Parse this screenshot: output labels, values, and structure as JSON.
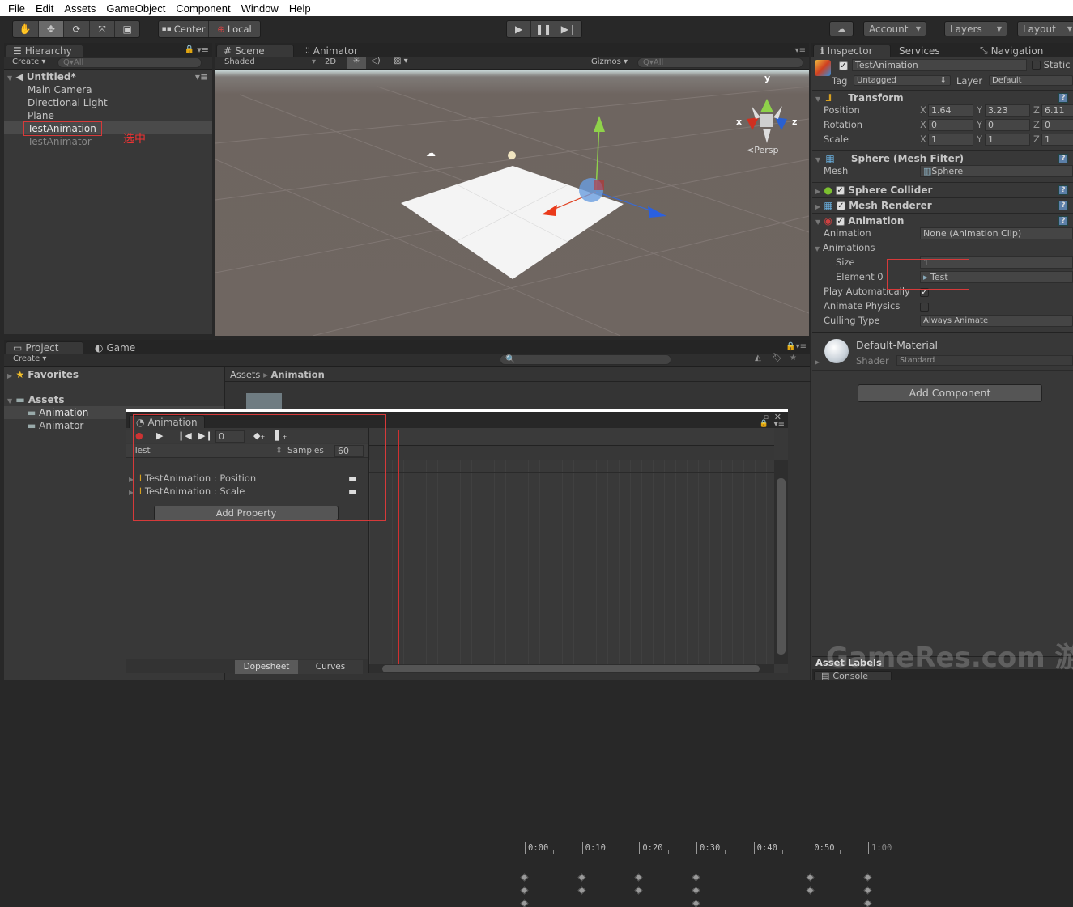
{
  "menu": [
    "File",
    "Edit",
    "Assets",
    "GameObject",
    "Component",
    "Window",
    "Help"
  ],
  "toolbar": {
    "tools": [
      "hand-icon",
      "move-icon",
      "rotate-icon",
      "scale-icon",
      "rect-icon"
    ],
    "active_tool": "move-icon",
    "pivot": "Center",
    "space": "Local",
    "play_controls": [
      "play-icon",
      "pause-icon",
      "step-icon"
    ],
    "account": "Account",
    "layers": "Layers",
    "layout": "Layout"
  },
  "hierarchy": {
    "tab": "Hierarchy",
    "create": "Create",
    "search_placeholder": "Q▾All",
    "scene": "Untitled*",
    "items": [
      "Main Camera",
      "Directional Light",
      "Plane",
      "TestAnimation",
      "TestAnimator"
    ],
    "selected": "TestAnimation",
    "annotation": "选中"
  },
  "scene": {
    "tabs": [
      "Scene",
      "Animator"
    ],
    "shading": "Shaded",
    "mode_2d": "2D",
    "gizmos": "Gizmos",
    "search_placeholder": "Q▾All",
    "axis_labels": {
      "x": "x",
      "y": "y",
      "z": "z"
    },
    "projection": "Persp"
  },
  "project": {
    "tabs": [
      "Project",
      "Game"
    ],
    "create": "Create",
    "favorites": "Favorites",
    "assets": "Assets",
    "folders": [
      "Animation",
      "Animator"
    ],
    "selected_folder": "Animation",
    "breadcrumb": [
      "Assets",
      "Animation"
    ]
  },
  "animation": {
    "tab": "Animation",
    "frame": "0",
    "clip": "Test",
    "samples_label": "Samples",
    "samples": "60",
    "properties": [
      "TestAnimation : Position",
      "TestAnimation : Scale"
    ],
    "add_property": "Add Property",
    "timeline_labels": [
      "0:00",
      "0:10",
      "0:20",
      "0:30",
      "0:40",
      "0:50",
      "1:00"
    ],
    "keyframes_frames": {
      "summary": [
        0,
        10,
        20,
        30,
        50,
        60
      ],
      "position": [
        0,
        10,
        20,
        30,
        50,
        60
      ],
      "scale": [
        0,
        30,
        60
      ]
    },
    "view_tabs": [
      "Dopesheet",
      "Curves"
    ],
    "active_view": "Dopesheet"
  },
  "inspector": {
    "tabs": [
      "Inspector",
      "Services",
      "Navigation"
    ],
    "object_name": "TestAnimation",
    "active": true,
    "static_label": "Static",
    "tag_label": "Tag",
    "tag": "Untagged",
    "layer_label": "Layer",
    "layer": "Default",
    "transform": {
      "title": "Transform",
      "rows": [
        {
          "label": "Position",
          "x": "1.64",
          "y": "3.23",
          "z": "6.11"
        },
        {
          "label": "Rotation",
          "x": "0",
          "y": "0",
          "z": "0"
        },
        {
          "label": "Scale",
          "x": "1",
          "y": "1",
          "z": "1"
        }
      ]
    },
    "mesh_filter": {
      "title": "Sphere (Mesh Filter)",
      "mesh_label": "Mesh",
      "mesh": "Sphere"
    },
    "sphere_collider": "Sphere Collider",
    "mesh_renderer": "Mesh Renderer",
    "animation_comp": {
      "title": "Animation",
      "animation_label": "Animation",
      "animation_value": "None (Animation Clip)",
      "animations_label": "Animations",
      "size_label": "Size",
      "size": "1",
      "element0_label": "Element 0",
      "element0": "Test",
      "play_auto_label": "Play Automatically",
      "play_auto": true,
      "animate_physics_label": "Animate Physics",
      "animate_physics": false,
      "culling_label": "Culling Type",
      "culling": "Always Animate"
    },
    "material": {
      "name": "Default-Material",
      "shader_label": "Shader",
      "shader": "Standard"
    },
    "add_component": "Add Component",
    "asset_labels": "Asset Labels",
    "console_tab": "Console"
  },
  "watermark": "GameRes.com 游资网",
  "colors": {
    "accent_red": "#d63a3a",
    "selection": "#4a4a4a",
    "scene_bg": "#6e6560"
  }
}
